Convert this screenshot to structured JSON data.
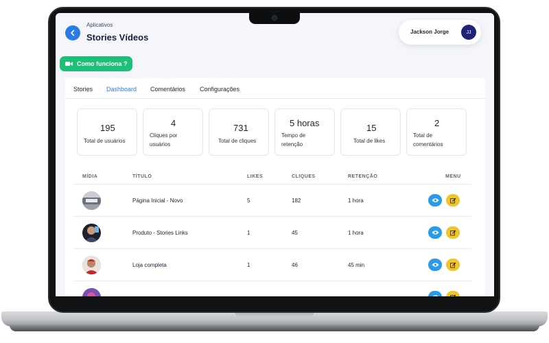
{
  "header": {
    "breadcrumb": "Aplicativos",
    "title": "Stories Vídeos",
    "back_icon": "arrow-left-icon"
  },
  "user": {
    "name": "Jackson Jorge",
    "initials": "JJ"
  },
  "how_button": {
    "label": "Como funciona ?",
    "icon": "video-camera-icon"
  },
  "tabs": [
    {
      "label": "Stories",
      "active": false
    },
    {
      "label": "Dashboard",
      "active": true
    },
    {
      "label": "Comentários",
      "active": false
    },
    {
      "label": "Configurações",
      "active": false
    }
  ],
  "stats": [
    {
      "value": "195",
      "label": "Total de usuários"
    },
    {
      "value": "4",
      "label": "Cliques por usuários"
    },
    {
      "value": "731",
      "label": "Total de cliques"
    },
    {
      "value": "5 horas",
      "label": "Tempo de retenção"
    },
    {
      "value": "15",
      "label": "Total de likes"
    },
    {
      "value": "2",
      "label": "Total de comentários"
    }
  ],
  "table": {
    "headers": {
      "media": "MÍDIA",
      "title": "TÍTULO",
      "likes": "LIKES",
      "clicks": "CLIQUES",
      "retention": "RETENÇÃO",
      "menu": "MENU"
    },
    "rows": [
      {
        "title": "Página Inicial - Novo",
        "likes": "5",
        "clicks": "182",
        "retention": "1 hora"
      },
      {
        "title": "Produto - Stories Links",
        "likes": "1",
        "clicks": "45",
        "retention": "1 hora"
      },
      {
        "title": "Loja completa",
        "likes": "1",
        "clicks": "46",
        "retention": "45 min"
      }
    ]
  },
  "colors": {
    "accent": "#2a7be4",
    "success": "#1fbf77",
    "view": "#2a9be8",
    "edit": "#efc42d",
    "avatar": "#1f2474"
  }
}
